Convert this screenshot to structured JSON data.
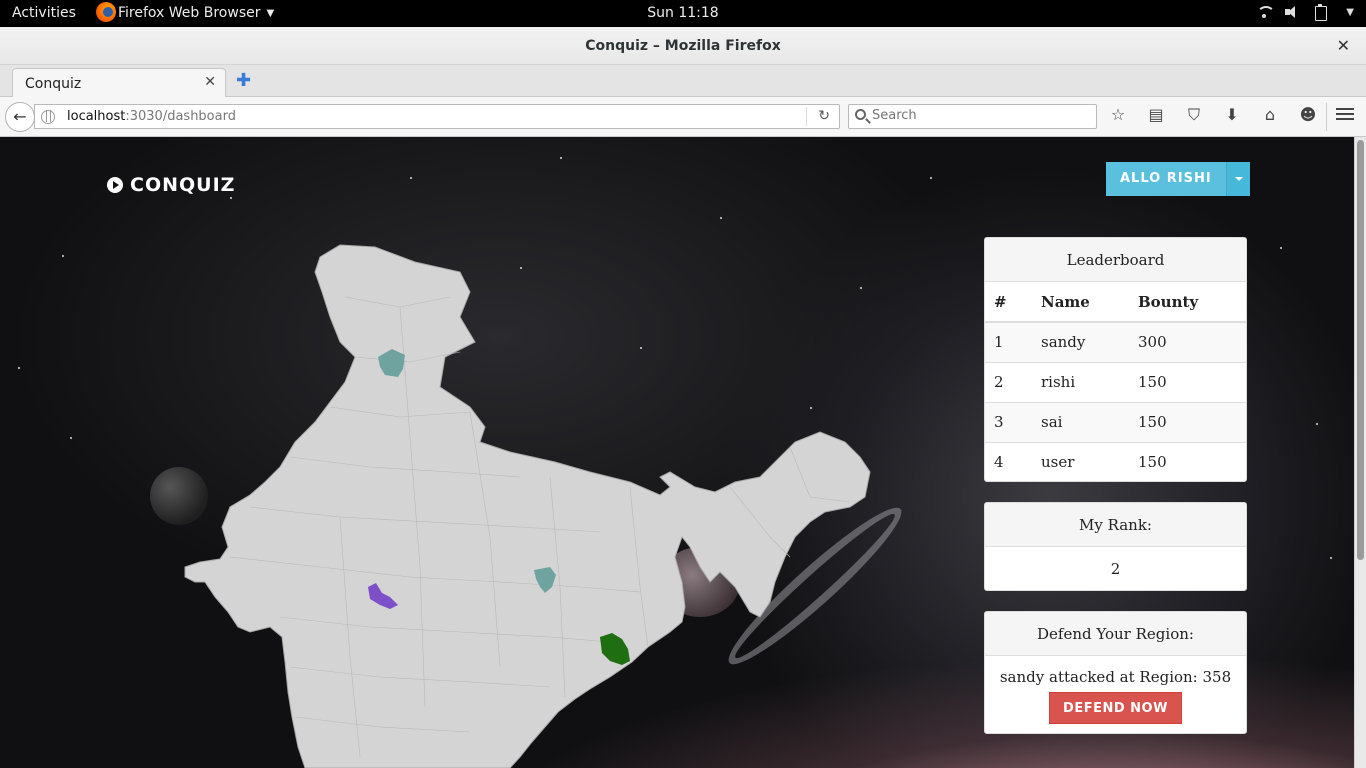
{
  "system": {
    "activities": "Activities",
    "app_menu": "Firefox Web Browser",
    "clock": "Sun 11:18"
  },
  "window": {
    "title": "Conquiz – Mozilla Firefox"
  },
  "browser": {
    "tab_title": "Conquiz",
    "url_host": "localhost",
    "url_rest": ":3030/dashboard",
    "search_placeholder": "Search"
  },
  "site": {
    "brand": "CONQUIZ",
    "user_button": "ALLO RISHI"
  },
  "map": {
    "highlighted_regions": [
      {
        "color": "#6fa3a0"
      },
      {
        "color": "#7d4fc9"
      },
      {
        "color": "#6fa3a0"
      },
      {
        "color": "#1f6e12"
      }
    ],
    "base_color": "#d4d4d4"
  },
  "leaderboard": {
    "title": "Leaderboard",
    "columns": [
      "#",
      "Name",
      "Bounty"
    ],
    "rows": [
      {
        "rank": "1",
        "name": "sandy",
        "bounty": "300"
      },
      {
        "rank": "2",
        "name": "rishi",
        "bounty": "150"
      },
      {
        "rank": "3",
        "name": "sai",
        "bounty": "150"
      },
      {
        "rank": "4",
        "name": "user",
        "bounty": "150"
      }
    ]
  },
  "my_rank": {
    "title": "My Rank:",
    "value": "2"
  },
  "defend": {
    "title": "Defend Your Region:",
    "message": "sandy attacked at Region: 358",
    "button": "DEFEND NOW"
  },
  "colors": {
    "accent": "#5bc0de",
    "danger": "#d9534f"
  }
}
